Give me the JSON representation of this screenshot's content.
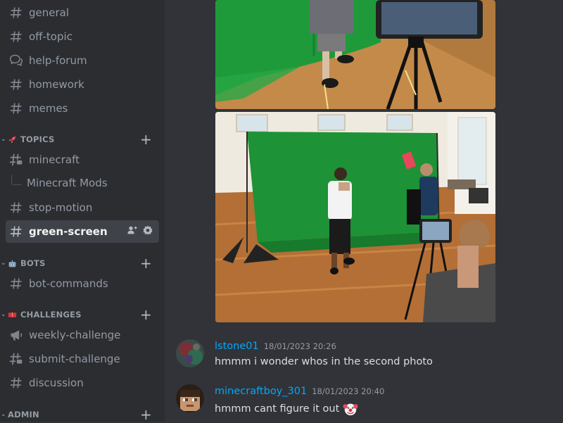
{
  "sidebar": {
    "channels_top": [
      {
        "name": "general",
        "icon": "hash-icon"
      },
      {
        "name": "off-topic",
        "icon": "hash-icon"
      },
      {
        "name": "help-forum",
        "icon": "forum-icon"
      },
      {
        "name": "homework",
        "icon": "hash-icon"
      },
      {
        "name": "memes",
        "icon": "hash-icon"
      }
    ],
    "categories": [
      {
        "name": "TOPICS",
        "emoji": "rocket-emoji"
      },
      {
        "name": "BOTS",
        "emoji": "robot-emoji"
      },
      {
        "name": "CHALLENGES",
        "emoji": "ticket-emoji"
      },
      {
        "name": "ADMIN"
      }
    ],
    "topics": [
      {
        "name": "minecraft",
        "icon": "hash-thread-icon"
      },
      {
        "name": "Minecraft Mods",
        "icon": "thread-spine"
      },
      {
        "name": "stop-motion",
        "icon": "hash-icon"
      },
      {
        "name": "green-screen",
        "icon": "hash-icon",
        "active": true
      }
    ],
    "bots": [
      {
        "name": "bot-commands",
        "icon": "hash-icon"
      }
    ],
    "challenges": [
      {
        "name": "weekly-challenge",
        "icon": "megaphone-icon"
      },
      {
        "name": "submit-challenge",
        "icon": "hash-thread-icon"
      },
      {
        "name": "discussion",
        "icon": "hash-icon"
      }
    ]
  },
  "messages": [
    {
      "username": "lstone01",
      "timestamp": "18/01/2023 20:26",
      "text": "hmmm i wonder whos in the second photo"
    },
    {
      "username": "minecraftboy_301",
      "timestamp": "18/01/2023 20:40",
      "text": "hmmm cant figure it out",
      "emoji": "clown-emoji"
    }
  ],
  "colors": {
    "sidebar": "#2b2d31",
    "main": "#313338",
    "username": "#00a8fc",
    "active": "#404249"
  }
}
